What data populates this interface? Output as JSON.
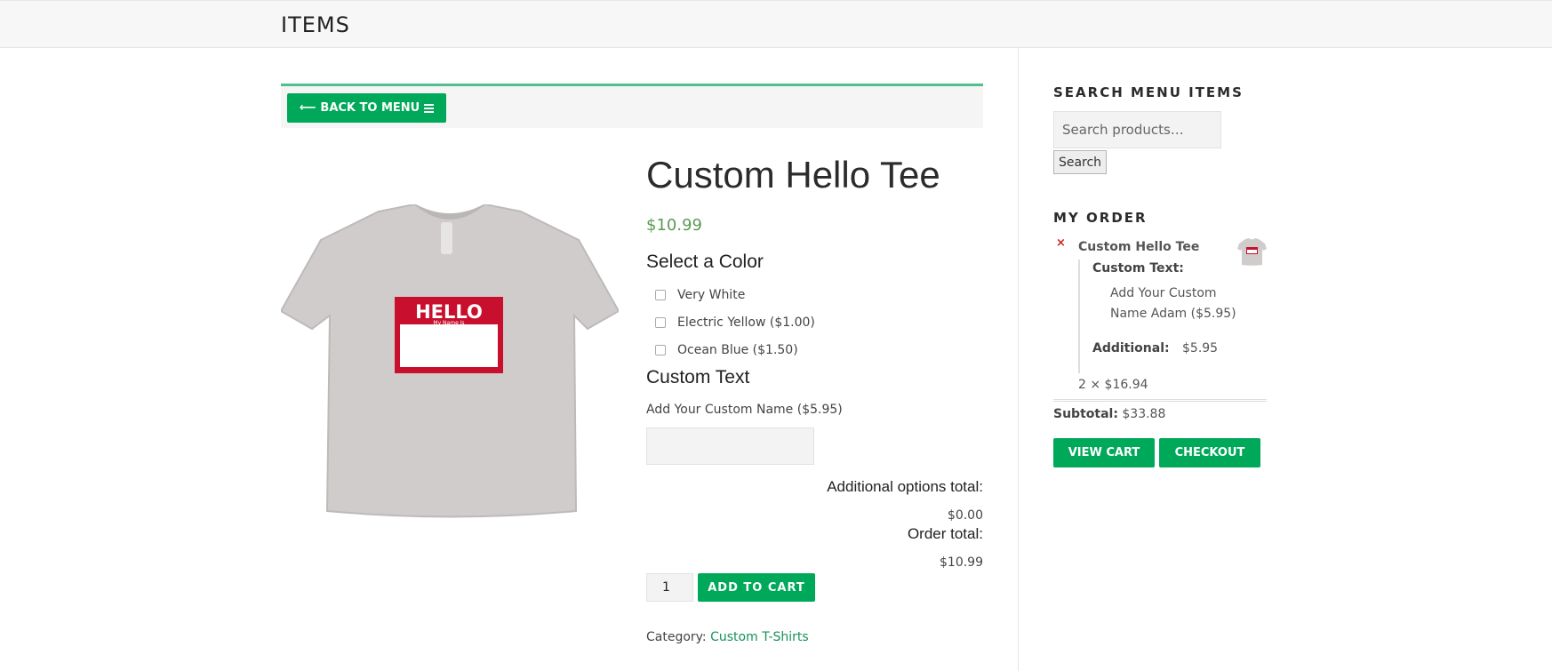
{
  "header": {
    "title": "ITEMS"
  },
  "back_button": {
    "label": "BACK TO MENU",
    "arrow": "⟵"
  },
  "product": {
    "image_alt": "t-shirt-image",
    "name": "Custom Hello Tee",
    "price": "$10.99",
    "color_heading": "Select a Color",
    "color_options": [
      {
        "label": "Very White",
        "checked": false
      },
      {
        "label": "Electric Yellow ($1.00)",
        "checked": false
      },
      {
        "label": "Ocean Blue ($1.50)",
        "checked": false
      }
    ],
    "custom_heading": "Custom Text",
    "custom_label": "Add Your Custom Name ($5.95)",
    "custom_value": "",
    "additional_total_label": "Additional options total:",
    "additional_total_value": "$0.00",
    "order_total_label": "Order total:",
    "order_total_value": "$10.99",
    "quantity": "1",
    "add_to_cart_label": "ADD TO CART",
    "category_label": "Category:",
    "category_link": "Custom T-Shirts",
    "shirt_text_hello": "HELLO",
    "shirt_text_sub": "My Name Is"
  },
  "sidebar": {
    "search_heading": "SEARCH MENU ITEMS",
    "search_placeholder": "Search products…",
    "search_button": "Search",
    "order_heading": "MY ORDER",
    "remove_icon": "×",
    "item_name": "Custom Hello Tee",
    "meta_key1": "Custom Text:",
    "meta_value1": "Add Your Custom Name Adam ($5.95)",
    "meta_key2": "Additional:",
    "meta_value2": "$5.95",
    "quantity_line": "2 × $16.94",
    "subtotal_label": "Subtotal:",
    "subtotal_value": "$33.88",
    "view_cart": "VIEW CART",
    "checkout": "CHECKOUT"
  },
  "colors": {
    "accent": "#00a859",
    "price": "#5a9a54",
    "link": "#16925a",
    "remove": "#cc2222"
  }
}
